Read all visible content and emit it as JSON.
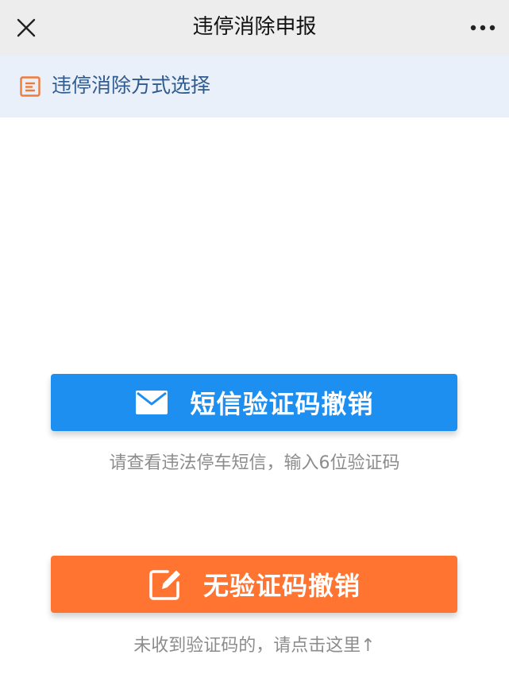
{
  "navbar": {
    "title": "违停消除申报",
    "close_icon": "close-icon",
    "more_icon": "more-icon"
  },
  "section": {
    "title": "违停消除方式选择",
    "icon": "document-icon",
    "accent_color": "#f07a3a"
  },
  "sms_option": {
    "button_label": "短信验证码撤销",
    "icon": "mail-icon",
    "color": "#1d8ff0",
    "hint": "请查看违法停车短信，输入6位验证码"
  },
  "nocode_option": {
    "button_label": "无验证码撤销",
    "icon": "edit-icon",
    "color": "#ff7430",
    "hint": "未收到验证码的，请点击这里↑"
  }
}
